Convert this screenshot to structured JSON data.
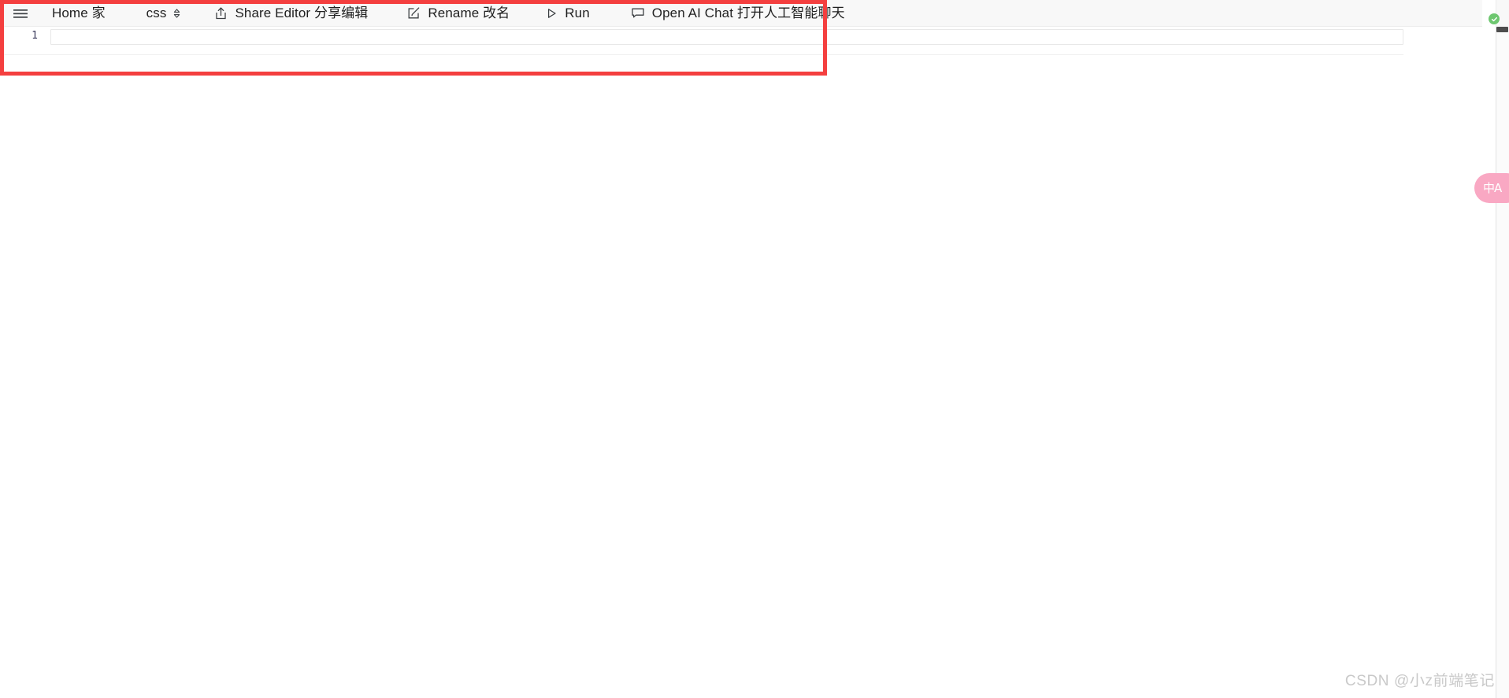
{
  "toolbar": {
    "menu_icon": "hamburger-icon",
    "home_label": "Home 家",
    "language_value": "css",
    "language_chevron_icon": "chevron-updown-icon",
    "share_icon": "share-upload-icon",
    "share_label": "Share Editor 分享编辑",
    "rename_icon": "edit-square-icon",
    "rename_label": "Rename 改名",
    "run_icon": "play-triangle-icon",
    "run_label": "Run",
    "chat_icon": "chat-bubble-icon",
    "chat_label": "Open AI Chat 打开人工智能聊天"
  },
  "editor": {
    "line_numbers": [
      "1"
    ],
    "lines": [
      ""
    ],
    "placeholder": ""
  },
  "annotation": {
    "highlight_color": "#f43f3f",
    "highlight_label": "editor-toolbar-highlight"
  },
  "translate_widget": {
    "glyph": "中A",
    "status_icon": "check-circle-icon",
    "accent_color": "#f9a8c3",
    "status_color": "#6ec770"
  },
  "scrollbar": {
    "orientation": "vertical"
  },
  "watermark": {
    "text": "CSDN @小z前端笔记"
  }
}
